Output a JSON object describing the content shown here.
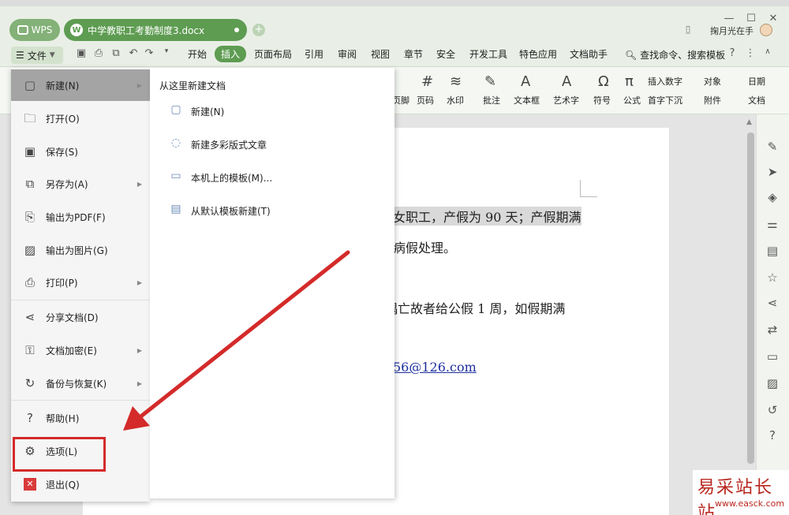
{
  "window": {
    "wps_tab": "WPS",
    "doc_tab": "中学教职工考勤制度3.docx",
    "doc_logo": "W",
    "add_tab": "+",
    "user_name": "掬月光在手",
    "win_minimize": "—",
    "win_maximize": "☐",
    "win_close": "✕"
  },
  "menubar": {
    "file_label": "文件",
    "tabs": [
      "开始",
      "插入",
      "页面布局",
      "引用",
      "审阅",
      "视图",
      "章节",
      "安全",
      "开发工具",
      "特色应用",
      "文档助手"
    ],
    "active_tab": "插入",
    "search": "查找命令、搜索模板"
  },
  "ribbon": {
    "items": [
      "页脚",
      "页码",
      "水印",
      "批注",
      "文本框",
      "艺术字",
      "符号",
      "公式"
    ],
    "small_items": [
      "插入数字",
      "对象",
      "日期",
      "首字下沉",
      "附件",
      "文档"
    ]
  },
  "file_menu": {
    "items": [
      {
        "label": "新建(N)",
        "icon": "new-icon",
        "submenu": true
      },
      {
        "label": "打开(O)",
        "icon": "folder-icon",
        "submenu": false
      },
      {
        "label": "保存(S)",
        "icon": "save-icon",
        "submenu": false
      },
      {
        "label": "另存为(A)",
        "icon": "save-as-icon",
        "submenu": true
      },
      {
        "label": "输出为PDF(F)",
        "icon": "pdf-icon",
        "submenu": false
      },
      {
        "label": "输出为图片(G)",
        "icon": "image-icon",
        "submenu": false
      },
      {
        "label": "打印(P)",
        "icon": "print-icon",
        "submenu": true
      },
      {
        "label": "分享文档(D)",
        "icon": "share-icon",
        "submenu": false
      },
      {
        "label": "文档加密(E)",
        "icon": "encrypt-icon",
        "submenu": true
      },
      {
        "label": "备份与恢复(K)",
        "icon": "backup-icon",
        "submenu": true
      },
      {
        "label": "帮助(H)",
        "icon": "help-icon",
        "submenu": true
      },
      {
        "label": "选项(L)",
        "icon": "gear-icon",
        "submenu": false
      },
      {
        "label": "退出(Q)",
        "icon": "exit-icon",
        "submenu": false
      }
    ]
  },
  "submenu": {
    "header": "从这里新建文档",
    "items": [
      "新建(N)",
      "新建多彩版式文章",
      "本机上的模板(M)...",
      "从默认模板新建(T)"
    ]
  },
  "document": {
    "lines": [
      "女职工，产假为 90 天；产假期满",
      "病假处理。",
      "偶亡故者给公假 1 周，如假期满",
      "56@126.com"
    ]
  },
  "watermark": {
    "cn": "易采站长站",
    "url": "www.easck.com"
  },
  "colors": {
    "accent_green": "#5e9c52",
    "annotation_red": "#d42a2a"
  }
}
